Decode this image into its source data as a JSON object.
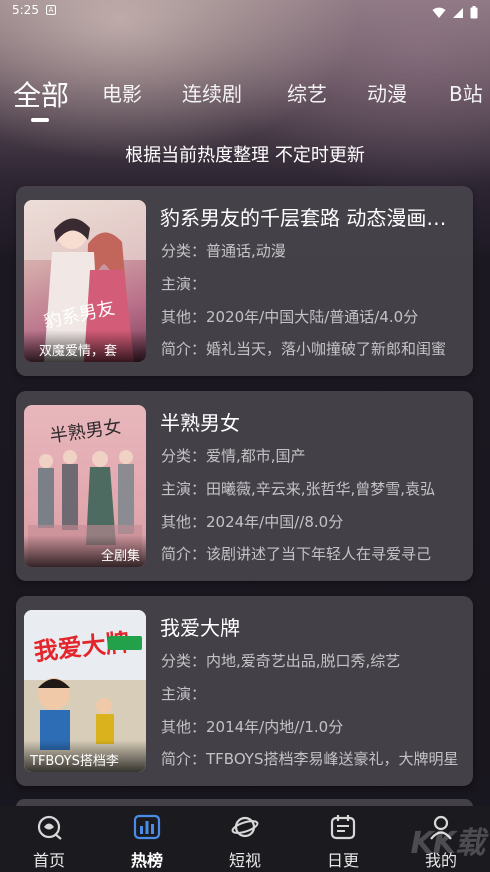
{
  "status_bar": {
    "time": "5:25",
    "notif_icon": "A"
  },
  "tabs": [
    {
      "label": "全部",
      "active": true
    },
    {
      "label": "电影"
    },
    {
      "label": "连续剧"
    },
    {
      "label": "综艺"
    },
    {
      "label": "动漫"
    },
    {
      "label": "B站"
    }
  ],
  "subtitle": "根据当前热度整理 不定时更新",
  "cards": [
    {
      "title": "豹系男友的千层套路 动态漫画第一季",
      "poster_caption": "双魔爱情，套",
      "category": "分类：普通话,动漫",
      "cast": "主演：",
      "other": "其他：2020年/中国大陆/普通话/4.0分",
      "summary": "简介：婚礼当天，落小咖撞破了新郎和闺蜜"
    },
    {
      "title": "半熟男女",
      "poster_caption": "全剧集",
      "category": "分类：爱情,都市,国产",
      "cast": "主演：田曦薇,辛云来,张哲华,曾梦雪,袁弘",
      "other": "其他：2024年/中国//8.0分",
      "summary": "简介：该剧讲述了当下年轻人在寻爱寻己"
    },
    {
      "title": "我爱大牌",
      "poster_caption": "TFBOYS搭档李",
      "category": "分类：内地,爱奇艺出品,脱口秀,综艺",
      "cast": "主演：",
      "other": "其他：2014年/内地//1.0分",
      "summary": "简介：TFBOYS搭档李易峰送豪礼，大牌明星"
    }
  ],
  "nav": [
    {
      "label": "首页",
      "icon": "home-icon"
    },
    {
      "label": "热榜",
      "icon": "chart-icon",
      "active": true
    },
    {
      "label": "短视",
      "icon": "planet-icon"
    },
    {
      "label": "日更",
      "icon": "calendar-icon"
    },
    {
      "label": "我的",
      "icon": "profile-icon"
    }
  ],
  "watermark": "KK载"
}
